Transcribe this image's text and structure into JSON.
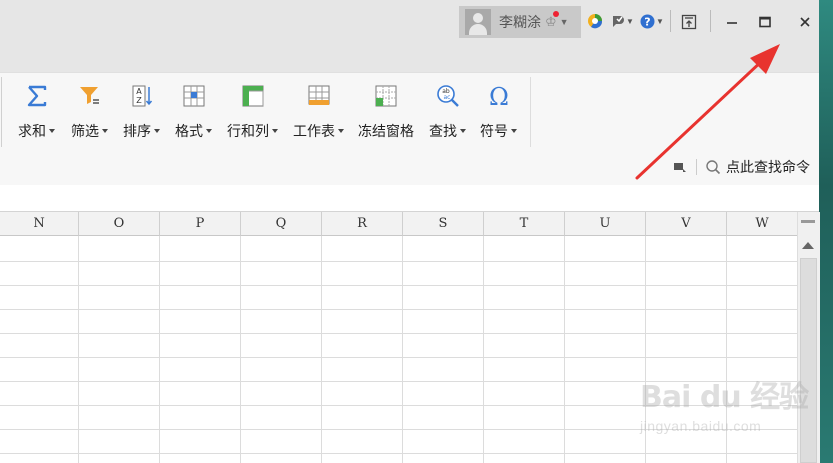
{
  "titlebar": {
    "user_name": "李糊涂"
  },
  "ribbon": {
    "buttons": [
      {
        "label": "求和",
        "icon": "sigma-sum-icon"
      },
      {
        "label": "筛选",
        "icon": "filter-funnel-icon"
      },
      {
        "label": "排序",
        "icon": "sort-az-icon"
      },
      {
        "label": "格式",
        "icon": "format-grid-icon"
      },
      {
        "label": "行和列",
        "icon": "rows-columns-icon"
      },
      {
        "label": "工作表",
        "icon": "worksheet-icon"
      },
      {
        "label": "冻结窗格",
        "icon": "freeze-panes-icon"
      },
      {
        "label": "查找",
        "icon": "find-magnifier-icon"
      },
      {
        "label": "符号",
        "icon": "omega-symbol-icon"
      }
    ],
    "command_search": "点此查找命令"
  },
  "sheet": {
    "columns": [
      "N",
      "O",
      "P",
      "Q",
      "R",
      "S",
      "T",
      "U",
      "V",
      "W"
    ]
  },
  "watermark": {
    "logo": "Bai du 经验",
    "url": "jingyan.baidu.com"
  },
  "colors": {
    "accent_blue": "#3a7bd5",
    "annotation_red": "#e8332f",
    "filter_orange": "#f0a030"
  }
}
